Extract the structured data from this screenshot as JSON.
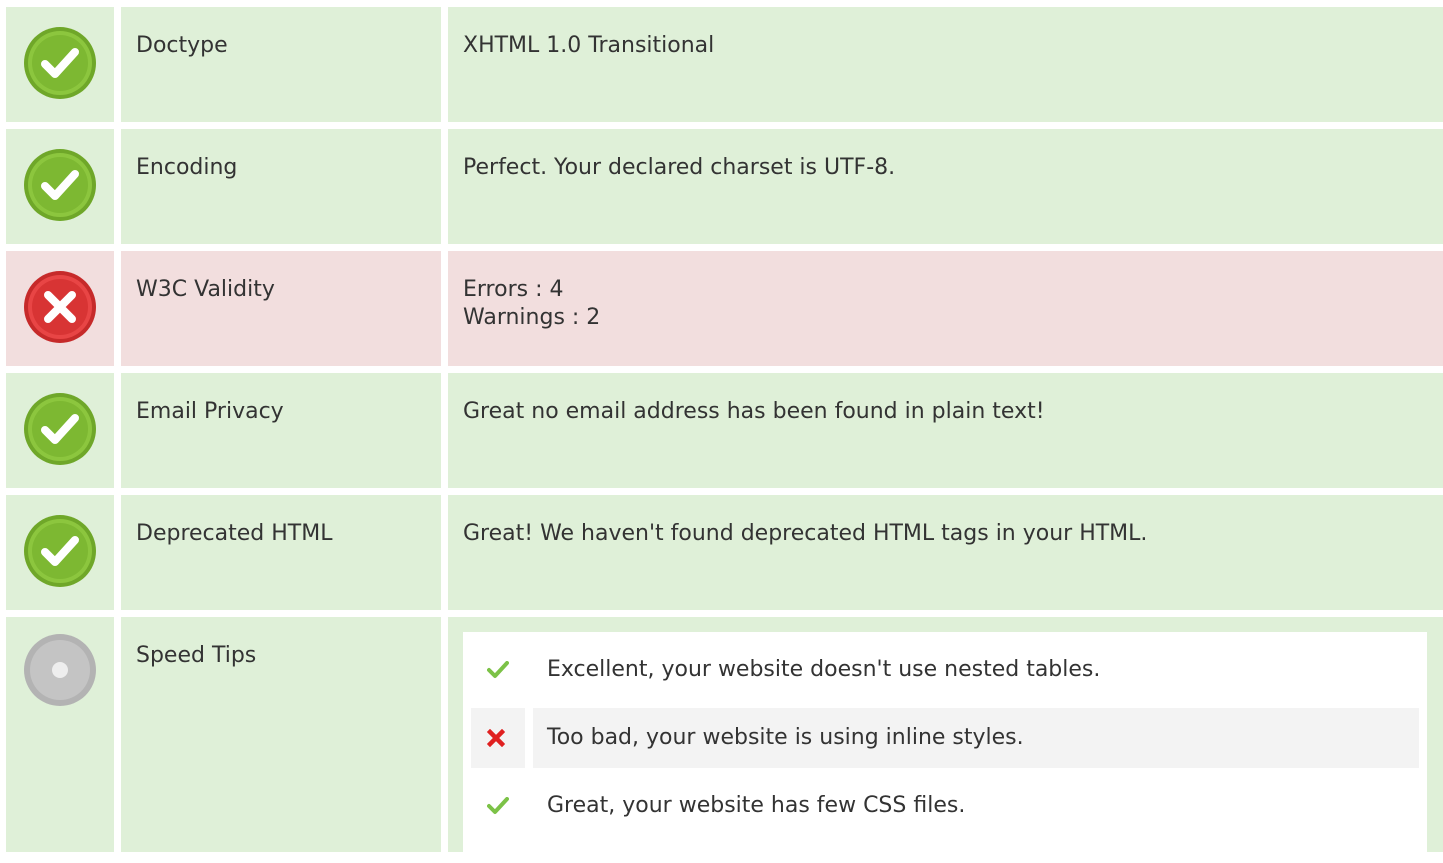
{
  "checks": [
    {
      "label": "Doctype",
      "value": "XHTML 1.0 Transitional",
      "status": "pass",
      "icon": "check-circle-icon"
    },
    {
      "label": "Encoding",
      "value": "Perfect. Your declared charset is UTF-8.",
      "status": "pass",
      "icon": "check-circle-icon"
    },
    {
      "label": "W3C Validity",
      "value": "Errors : 4\nWarnings : 2",
      "status": "fail",
      "icon": "x-circle-icon"
    },
    {
      "label": "Email Privacy",
      "value": "Great no email address has been found in plain text!",
      "status": "pass",
      "icon": "check-circle-icon"
    },
    {
      "label": "Deprecated HTML",
      "value": "Great! We haven't found deprecated HTML tags in your HTML.",
      "status": "pass",
      "icon": "check-circle-icon"
    }
  ],
  "speed_tips": {
    "label": "Speed Tips",
    "icon": "info-circle-icon",
    "items": [
      {
        "text": "Excellent, your website doesn't use nested tables.",
        "status": "pass",
        "icon": "check-icon"
      },
      {
        "text": "Too bad, your website is using inline styles.",
        "status": "fail",
        "icon": "x-icon"
      },
      {
        "text": "Great, your website has few CSS files.",
        "status": "pass",
        "icon": "check-icon"
      }
    ]
  },
  "colors": {
    "pass_bg": "#dff0d8",
    "fail_bg": "#f2dede",
    "pass_icon": "#8cc63e",
    "fail_icon": "#e84545",
    "neutral_icon": "#b3b3b3"
  }
}
